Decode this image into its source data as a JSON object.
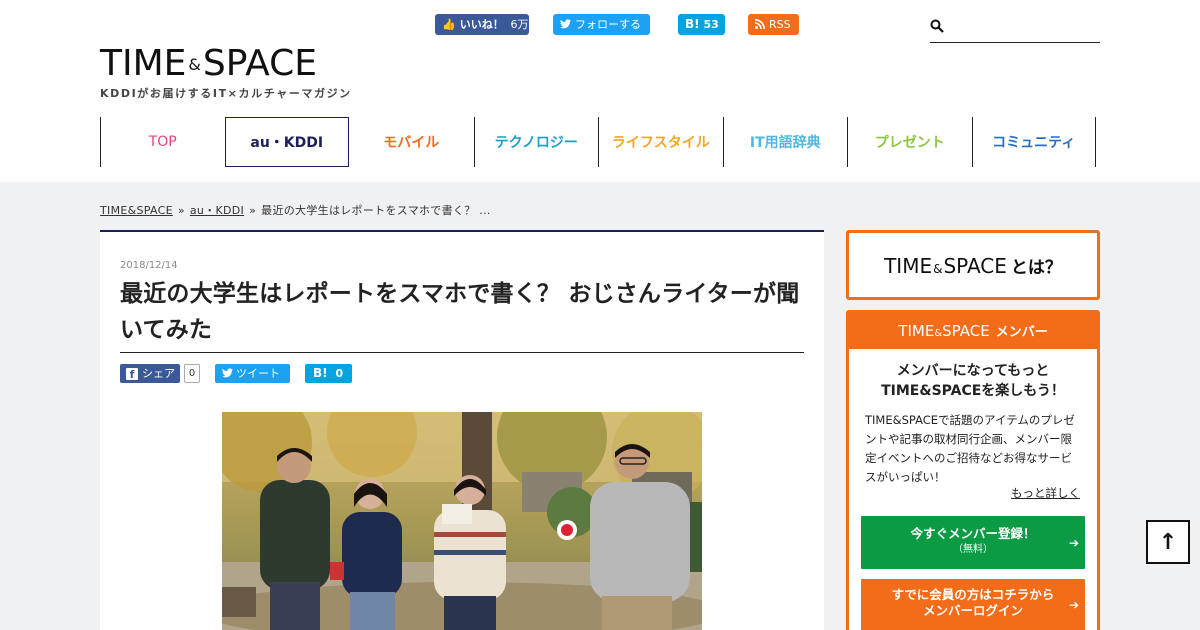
{
  "header": {
    "logo": {
      "part1": "TIME",
      "amp": "&",
      "part2": "SPACE",
      "tagline": "KDDIがお届けするIT×カルチャーマガジン"
    },
    "social": {
      "fb_like_label": "いいね！",
      "fb_like_count": "6万",
      "tw_follow_label": "フォローする",
      "hatena_label": "B!",
      "hatena_count": "53",
      "rss_label": "RSS"
    },
    "search": {
      "placeholder": ""
    },
    "nav": [
      {
        "label": "TOP",
        "color": "#e8447a"
      },
      {
        "label": "au・KDDI",
        "color": "#1c1f5a"
      },
      {
        "label": "モバイル",
        "color": "#f26c1a"
      },
      {
        "label": "テクノロジー",
        "color": "#1aa0c8"
      },
      {
        "label": "ライフスタイル",
        "color": "#f5a623"
      },
      {
        "label": "IT用語辞典",
        "color": "#4fb8e0"
      },
      {
        "label": "プレゼント",
        "color": "#8cc63f"
      },
      {
        "label": "コミュニティ",
        "color": "#2a6fc0"
      }
    ]
  },
  "breadcrumb": {
    "items": [
      "TIME&SPACE",
      "au・KDDI"
    ],
    "separator": "»",
    "current": "最近の大学生はレポートをスマホで書く？ ..."
  },
  "article": {
    "date": "2018/12/14",
    "title": "最近の大学生はレポートをスマホで書く？ おじさんライターが聞いてみた",
    "share": {
      "fb_label": "シェア",
      "fb_count": "0",
      "tw_label": "ツイート",
      "hatena_label": "B!",
      "hatena_count": "0"
    }
  },
  "sidebar": {
    "about": {
      "part1": "TIME",
      "amp": "&",
      "part2": "SPACE",
      "suffix": "とは？"
    },
    "member": {
      "head_part1": "TIME",
      "head_amp": "&",
      "head_part2": "SPACE",
      "head_suffix": "メンバー",
      "lead_line1": "メンバーになってもっと",
      "lead_line2": "TIME&SPACEを楽しもう！",
      "description": "TIME&SPACEで話題のアイテムのプレゼントや記事の取材同行企画、メンバー限定イベントへのご招待などお得なサービスがいっぱい！",
      "more_link": "もっと詳しく",
      "register_line1": "今すぐメンバー登録！",
      "register_line2": "（無料）",
      "login_line1": "すでに会員の方はコチラから",
      "login_line2": "メンバーログイン"
    }
  },
  "colors": {
    "accent": "#f26c1a",
    "navy": "#1c1f5a",
    "green": "#0c9b45"
  }
}
